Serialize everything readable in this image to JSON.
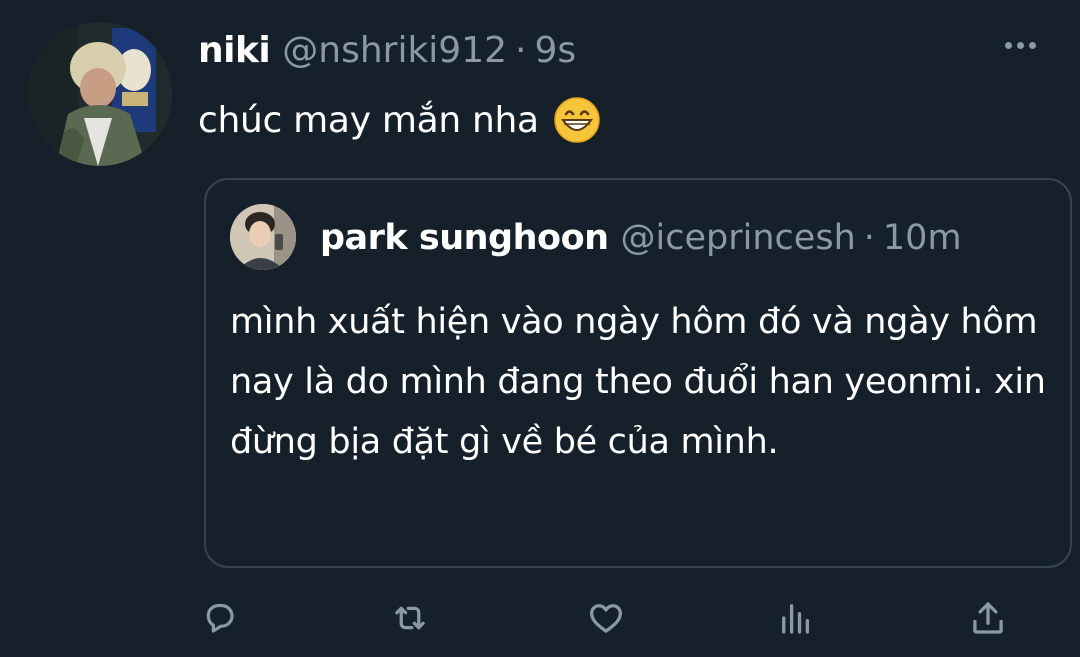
{
  "tweet": {
    "author_name": "niki",
    "author_handle": "@nshriki912",
    "separator": "·",
    "timestamp": "9s",
    "text": "chúc may mắn nha"
  },
  "quoted_tweet": {
    "author_name": "park sunghoon",
    "author_handle": "@iceprincesh",
    "separator": "·",
    "timestamp": "10m",
    "text": "mình xuất hiện vào ngày hôm đó và ngày hôm nay là do mình đang theo đuổi han yeonmi. xin đừng bịa đặt gì về bé của mình."
  },
  "actions": [
    {
      "icon": "reply-icon"
    },
    {
      "icon": "retweet-icon"
    },
    {
      "icon": "like-icon"
    },
    {
      "icon": "analytics-icon"
    },
    {
      "icon": "share-icon"
    }
  ],
  "colors": {
    "background": "#15202b",
    "text_primary": "#ffffff",
    "text_secondary": "#8b98a5",
    "border": "#38444d"
  }
}
